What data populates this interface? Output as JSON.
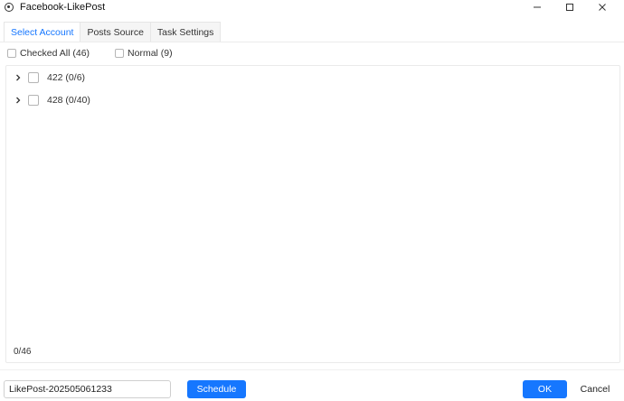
{
  "window": {
    "title": "Facebook-LikePost",
    "icon": "app-logo-icon",
    "controls": [
      "minimize-icon",
      "maximize-icon",
      "close-icon"
    ]
  },
  "tabs": [
    {
      "label": "Select Account",
      "active": true
    },
    {
      "label": "Posts Source",
      "active": false
    },
    {
      "label": "Task Settings",
      "active": false
    }
  ],
  "filters": {
    "checked_all": {
      "label": "Checked All (46)",
      "checked": false
    },
    "normal": {
      "label": "Normal (9)",
      "checked": false
    }
  },
  "tree": {
    "groups": [
      {
        "label": "422 (0/6)",
        "expanded": false,
        "checked": false
      },
      {
        "label": "428 (0/40)",
        "expanded": false,
        "checked": false
      }
    ],
    "selection_count": "0/46"
  },
  "footer": {
    "task_name_value": "LikePost-202505061233",
    "schedule_label": "Schedule",
    "ok_label": "OK",
    "cancel_label": "Cancel"
  },
  "colors": {
    "accent": "#1677ff",
    "border": "#eaeaea"
  }
}
